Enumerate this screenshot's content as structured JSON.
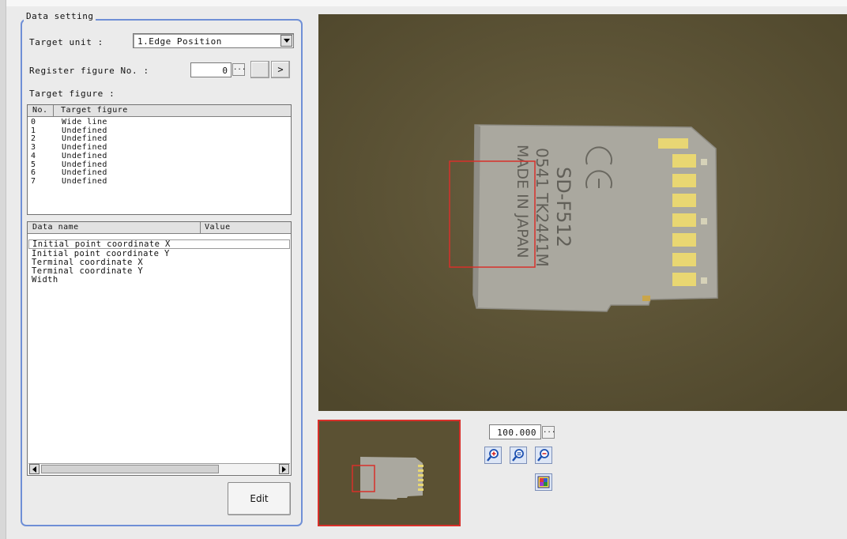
{
  "data_setting": {
    "title": "Data setting",
    "target_unit_label": "Target unit :",
    "target_unit_value": "1.Edge Position",
    "register_figure_label": "Register figure No. :",
    "register_figure_value": "0",
    "dots_label": "...",
    "next_label": ">",
    "target_figure_label": "Target figure :",
    "figure_table": {
      "headers": [
        "No.",
        "Target figure"
      ],
      "rows": [
        {
          "no": "0",
          "name": "Wide line"
        },
        {
          "no": "1",
          "name": "Undefined"
        },
        {
          "no": "2",
          "name": "Undefined"
        },
        {
          "no": "3",
          "name": "Undefined"
        },
        {
          "no": "4",
          "name": "Undefined"
        },
        {
          "no": "5",
          "name": "Undefined"
        },
        {
          "no": "6",
          "name": "Undefined"
        },
        {
          "no": "7",
          "name": "Undefined"
        }
      ]
    },
    "data_table": {
      "headers": [
        "Data name",
        "Value"
      ],
      "rows": [
        "Initial point coordinate X",
        "Initial point coordinate Y",
        "Terminal coordinate X",
        "Terminal coordinate Y",
        "Width"
      ]
    },
    "edit_label": "Edit"
  },
  "image_view": {
    "card_text_line1": "SD-F512",
    "card_text_line2": "0541 TK2441M",
    "card_text_line3": "MADE IN JAPAN",
    "ce_mark": "CE",
    "zoom_value": "100.000",
    "zoom_dots": "...",
    "colors": {
      "region_box": "#d8302a",
      "background": "#5b5133",
      "card": "#a7a59c"
    }
  },
  "icons": [
    "zoom-in-icon",
    "zoom-fit-icon",
    "zoom-out-icon",
    "whole-image-icon"
  ]
}
